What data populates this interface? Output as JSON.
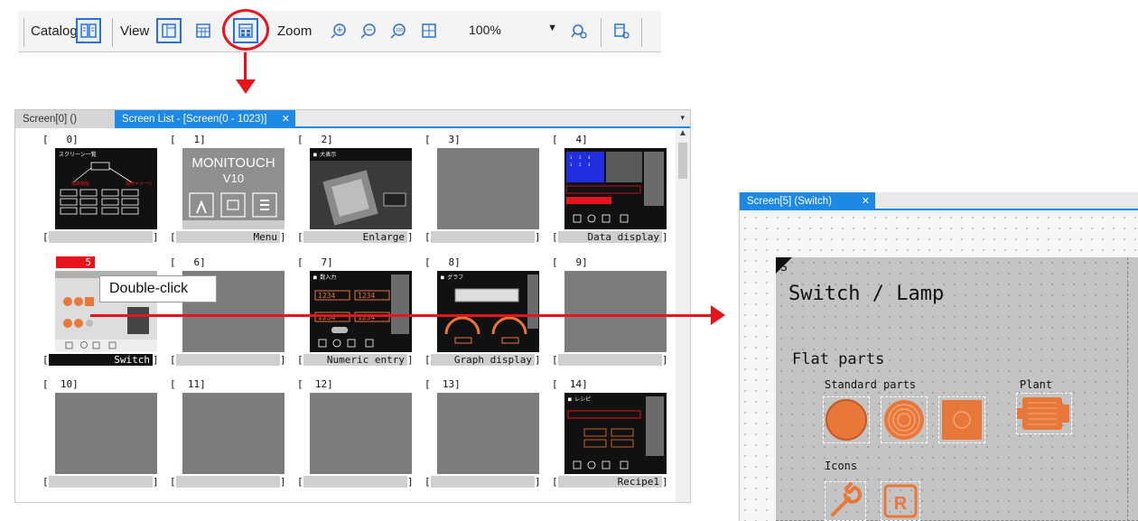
{
  "toolbar": {
    "catalog_label": "Catalog",
    "view_label": "View",
    "zoom_label": "Zoom",
    "zoom_value": "100%",
    "icons": [
      "catalog-book-icon",
      "view-layout-icon",
      "view-grid-icon",
      "screen-list-icon",
      "zoom-in-icon",
      "zoom-out-icon",
      "zoom-100-icon",
      "fit-to-window-icon",
      "zoom-settings-icon",
      "screen-settings-icon"
    ]
  },
  "annotation": {
    "double_click": "Double-click",
    "accent": "#e8141d"
  },
  "list_panel": {
    "tabs": [
      {
        "label": "Screen[0] ()",
        "active": false
      },
      {
        "label": "Screen List - [Screen(0 - 1023)]",
        "active": true,
        "close": "✕"
      }
    ],
    "menu_arrow": "▾",
    "screens": [
      {
        "idx": "[   0]",
        "name": "",
        "thumb": "list"
      },
      {
        "idx": "[   1]",
        "name": "Menu",
        "thumb": "monitouch",
        "thumb_title": "MONITOUCH",
        "thumb_sub": "V10"
      },
      {
        "idx": "[   2]",
        "name": "Enlarge",
        "thumb": "cpu"
      },
      {
        "idx": "[   3]",
        "name": "",
        "thumb": "blank"
      },
      {
        "idx": "[   4]",
        "name": "Data display",
        "thumb": "data"
      },
      {
        "idx": "[   5]",
        "name": "Switch",
        "thumb": "switch",
        "selected": true
      },
      {
        "idx": "[   6]",
        "name": "",
        "thumb": "blank"
      },
      {
        "idx": "[   7]",
        "name": "Numeric entry",
        "thumb": "numeric"
      },
      {
        "idx": "[   8]",
        "name": "Graph display",
        "thumb": "graph"
      },
      {
        "idx": "[   9]",
        "name": "",
        "thumb": "blank"
      },
      {
        "idx": "[  10]",
        "name": "",
        "thumb": "blank"
      },
      {
        "idx": "[  11]",
        "name": "",
        "thumb": "blank"
      },
      {
        "idx": "[  12]",
        "name": "",
        "thumb": "blank"
      },
      {
        "idx": "[  13]",
        "name": "",
        "thumb": "blank"
      },
      {
        "idx": "[  14]",
        "name": "Recipe1",
        "thumb": "recipe"
      }
    ]
  },
  "editor_panel": {
    "tab": {
      "label": "Screen[5] (Switch)",
      "close": "✕"
    },
    "corner_letter": "S",
    "title": "Switch / Lamp",
    "section": "Flat parts",
    "standard_parts": "Standard parts",
    "plant": "Plant",
    "icons_label": "Icons",
    "icon_r": "R",
    "part_color": "#e8773a"
  }
}
